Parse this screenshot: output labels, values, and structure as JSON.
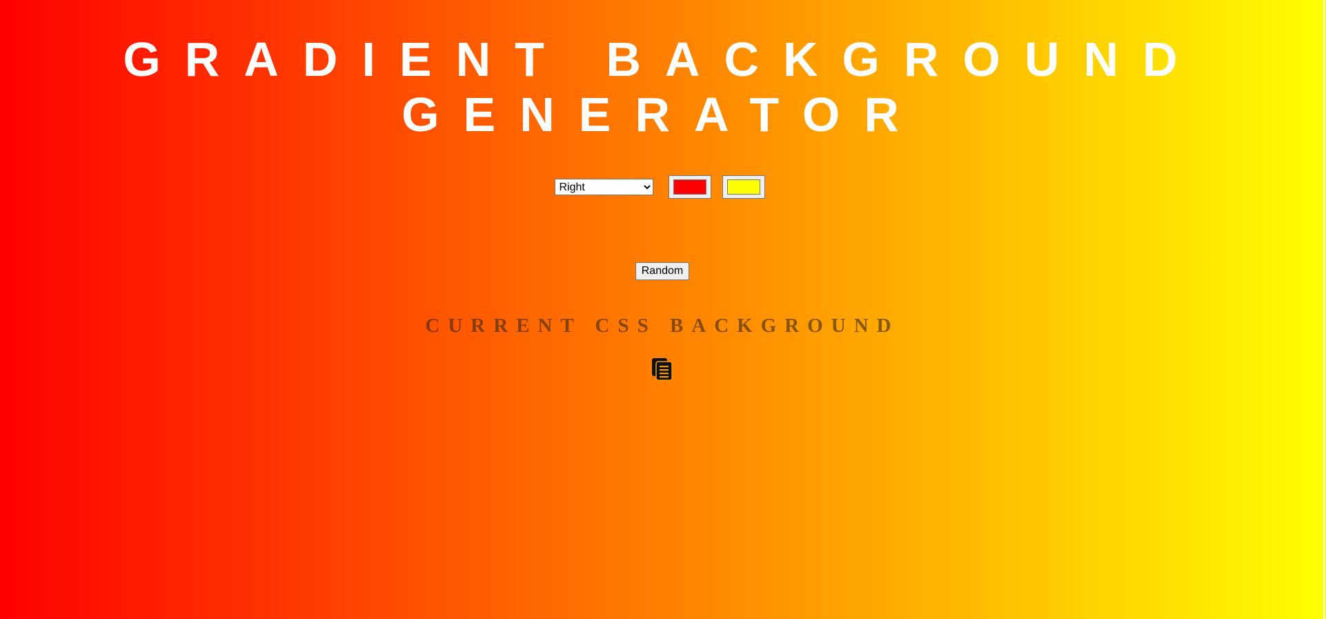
{
  "header": {
    "title_line1": "GRADIENT BACKGROUND",
    "title_line2": "GENERATOR"
  },
  "controls": {
    "direction_selected": "Right",
    "color1": "#ff0000",
    "color2": "#ffff00"
  },
  "random": {
    "label": "Random"
  },
  "output": {
    "heading": "CURRENT CSS BACKGROUND",
    "css_text": ""
  },
  "icons": {
    "copy": "copy-icon"
  }
}
